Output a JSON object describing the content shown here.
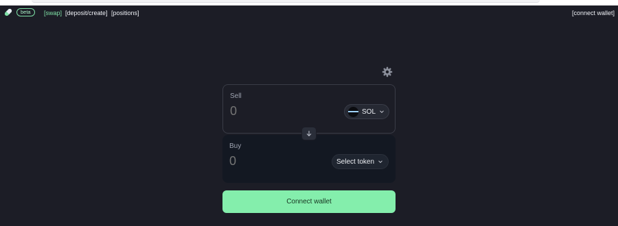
{
  "navbar": {
    "beta_label": "beta",
    "links": {
      "swap": "[swap]",
      "deposit": "[deposit/create]",
      "positions": "[positions]"
    },
    "connect_wallet": "[connect wallet]"
  },
  "swap": {
    "sell": {
      "label": "Sell",
      "amount_placeholder": "0",
      "token": "SOL"
    },
    "buy": {
      "label": "Buy",
      "amount_placeholder": "0",
      "token_button": "Select token"
    },
    "connect_button": "Connect wallet"
  },
  "colors": {
    "background": "#1c1d26",
    "accent": "#84eeac",
    "active_link": "#7fe0a6"
  },
  "icons": [
    "pill-logo-icon",
    "gear-icon",
    "arrow-down-icon",
    "solana-icon",
    "chevron-down-icon"
  ]
}
